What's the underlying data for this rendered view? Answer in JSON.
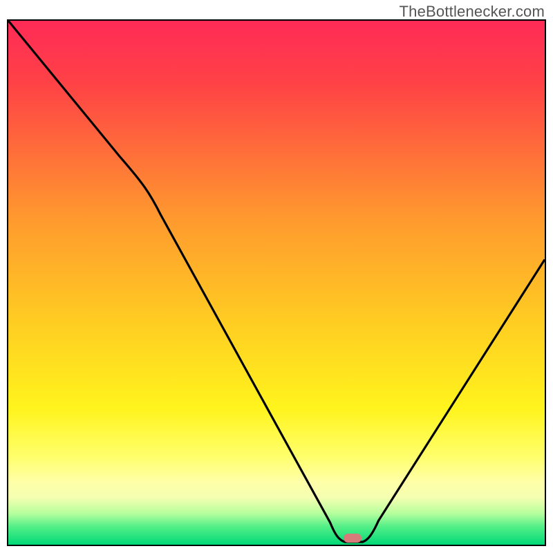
{
  "attribution": "TheBottlenecker.com",
  "colors": {
    "top": "#ff2b57",
    "mid": "#ffc326",
    "lightYellow": "#ffff8e",
    "green": "#00e07d",
    "curve": "#000000",
    "marker": "#d77a7a",
    "frame": "#000000"
  },
  "chart_data": {
    "type": "line",
    "title": "",
    "xlabel": "",
    "ylabel": "",
    "xlim": [
      0,
      100
    ],
    "ylim": [
      0,
      100
    ],
    "x": [
      0,
      20,
      27,
      60,
      62,
      66,
      68,
      100
    ],
    "values": [
      100,
      75,
      71,
      3,
      0,
      0,
      3,
      55
    ],
    "series_name": "bottleneck-curve",
    "annotations": [
      {
        "name": "optimal-marker",
        "x": 64,
        "y": 0
      }
    ],
    "background": "vertical rainbow gradient green→yellow→red"
  }
}
